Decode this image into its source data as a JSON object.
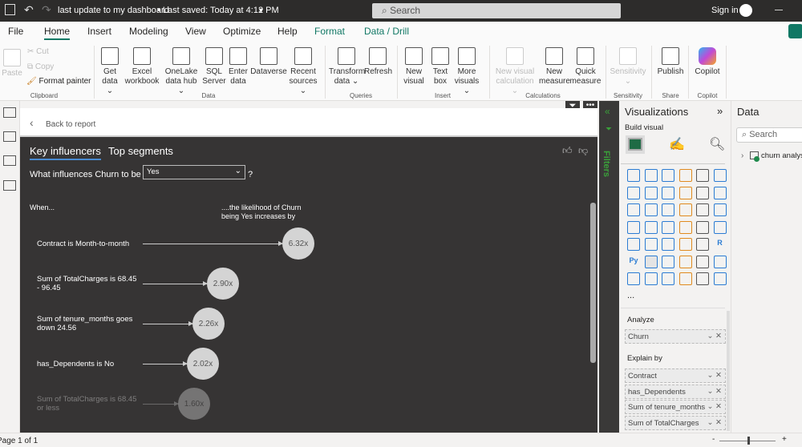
{
  "titlebar": {
    "doc_title": "last update to my dashboard",
    "saved": "• Last saved: Today at 4:12 PM",
    "search_placeholder": "Search",
    "sign_in": "Sign in"
  },
  "tabs": [
    "File",
    "Home",
    "Insert",
    "Modeling",
    "View",
    "Optimize",
    "Help",
    "Format",
    "Data / Drill"
  ],
  "ribbon": {
    "clipboard": {
      "paste": "Paste",
      "cut": "Cut",
      "copy": "Copy",
      "format_painter": "Format painter",
      "group": "Clipboard"
    },
    "data": {
      "items": [
        [
          "Get",
          "data ⌄"
        ],
        [
          "Excel",
          "workbook"
        ],
        [
          "OneLake",
          "data hub ⌄"
        ],
        [
          "SQL",
          "Server"
        ],
        [
          "Enter",
          "data"
        ],
        [
          "Dataverse",
          ""
        ],
        [
          "Recent",
          "sources ⌄"
        ]
      ],
      "group": "Data"
    },
    "queries": {
      "items": [
        [
          "Transform",
          "data ⌄"
        ],
        [
          "Refresh",
          ""
        ]
      ],
      "group": "Queries"
    },
    "insert": {
      "items": [
        [
          "New",
          "visual"
        ],
        [
          "Text",
          "box"
        ],
        [
          "More",
          "visuals ⌄"
        ]
      ],
      "group": "Insert"
    },
    "calculations": {
      "items": [
        [
          "New visual",
          "calculation ⌄"
        ],
        [
          "New",
          "measure"
        ],
        [
          "Quick",
          "measure"
        ]
      ],
      "group": "Calculations"
    },
    "sensitivity": {
      "items": [
        [
          "Sensitivity",
          "⌄"
        ]
      ],
      "group": "Sensitivity"
    },
    "share": {
      "items": [
        [
          "Publish",
          ""
        ]
      ],
      "group": "Share"
    },
    "copilot": {
      "items": [
        [
          "Copilot",
          ""
        ]
      ],
      "group": "Copilot"
    }
  },
  "visual": {
    "back": "Back to report",
    "tab_key": "Key influencers",
    "tab_top": "Top segments",
    "question": "What influences Churn to be",
    "selected_value": "Yes",
    "help": "?",
    "when": "When...",
    "likelihood": "....the likelihood of Churn being Yes increases by",
    "influencers": [
      {
        "label": "Contract is Month-to-month",
        "value": "6.32x"
      },
      {
        "label": "Sum of TotalCharges is 68.45 - 96.45",
        "value": "2.90x"
      },
      {
        "label": "Sum of tenure_months goes down 24.56",
        "value": "2.26x"
      },
      {
        "label": "has_Dependents is No",
        "value": "2.02x"
      },
      {
        "label": "Sum of TotalCharges is 68.45 or less",
        "value": "1.60x"
      }
    ]
  },
  "filters": {
    "label": "Filters"
  },
  "visualizations": {
    "title": "Visualizations",
    "build": "Build visual",
    "more": "...",
    "analyze": "Analyze",
    "analyze_field": "Churn",
    "explain_by": "Explain by",
    "explain_fields": [
      "Contract",
      "has_Dependents",
      "Sum of tenure_months",
      "Sum of TotalCharges"
    ],
    "icons": [
      "stacked-bar",
      "stacked-column",
      "clustered-bar",
      "clustered-column",
      "100-bar",
      "100-column",
      "line",
      "area",
      "stacked-area",
      "100-area",
      "line-column",
      "line-clustered",
      "ribbon",
      "waterfall",
      "funnel",
      "scatter",
      "pie",
      "donut",
      "treemap",
      "map",
      "filled-map",
      "azure-map",
      "gauge",
      "card",
      "multi-row-card",
      "kpi",
      "slicer",
      "table",
      "matrix",
      "R",
      "Py",
      "key-influencers",
      "decomposition-tree",
      "qa",
      "narrative",
      "goals",
      "paginated",
      "card-new",
      "slicer-new",
      "button-slicer",
      "power-apps",
      "power-automate"
    ]
  },
  "data_pane": {
    "title": "Data",
    "search_placeholder": "Search",
    "table": "churn analysis"
  },
  "status": {
    "page": "Page 1 of 1"
  }
}
